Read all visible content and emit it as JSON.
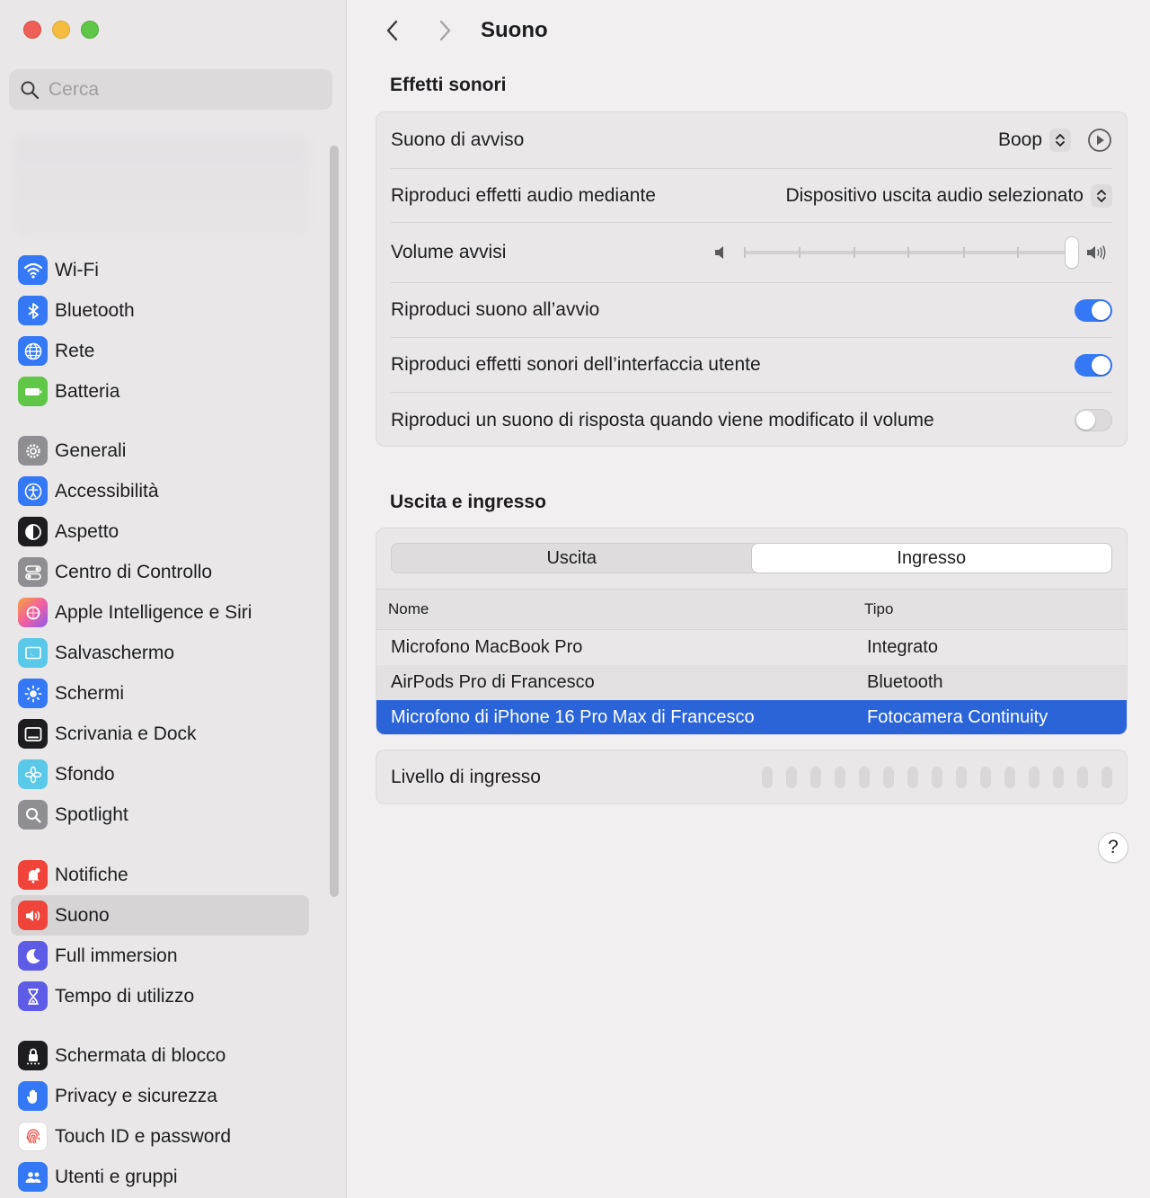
{
  "window": {
    "title": "Suono"
  },
  "sidebar": {
    "search_placeholder": "Cerca",
    "groups": [
      [
        {
          "label": "Wi-Fi",
          "icon": "wifi-icon",
          "color": "#3478f6"
        },
        {
          "label": "Bluetooth",
          "icon": "bluetooth-icon",
          "color": "#3478f6"
        },
        {
          "label": "Rete",
          "icon": "globe-icon",
          "color": "#3478f6"
        },
        {
          "label": "Batteria",
          "icon": "battery-icon",
          "color": "#5fc648"
        }
      ],
      [
        {
          "label": "Generali",
          "icon": "gear-icon",
          "color": "#8e8e93"
        },
        {
          "label": "Accessibilità",
          "icon": "accessibility-icon",
          "color": "#3478f6"
        },
        {
          "label": "Aspetto",
          "icon": "appearance-icon",
          "color": "#1d1d1f"
        },
        {
          "label": "Centro di Controllo",
          "icon": "control-center-icon",
          "color": "#8e8e93"
        },
        {
          "label": "Apple Intelligence e Siri",
          "icon": "siri-icon",
          "color": "#f25fa0"
        },
        {
          "label": "Salvaschermo",
          "icon": "screensaver-icon",
          "color": "#5ac8e8"
        },
        {
          "label": "Schermi",
          "icon": "sun-icon",
          "color": "#3478f6"
        },
        {
          "label": "Scrivania e Dock",
          "icon": "dock-icon",
          "color": "#1d1d1f"
        },
        {
          "label": "Sfondo",
          "icon": "flower-icon",
          "color": "#5ac8e8"
        },
        {
          "label": "Spotlight",
          "icon": "spotlight-icon",
          "color": "#8e8e93"
        }
      ],
      [
        {
          "label": "Notifiche",
          "icon": "bell-icon",
          "color": "#f0443a"
        },
        {
          "label": "Suono",
          "icon": "speaker-icon",
          "color": "#f0443a",
          "selected": true
        },
        {
          "label": "Full immersion",
          "icon": "moon-icon",
          "color": "#5e5ce6"
        },
        {
          "label": "Tempo di utilizzo",
          "icon": "hourglass-icon",
          "color": "#5e5ce6"
        }
      ],
      [
        {
          "label": "Schermata di blocco",
          "icon": "lock-icon",
          "color": "#1d1d1f"
        },
        {
          "label": "Privacy e sicurezza",
          "icon": "hand-icon",
          "color": "#3478f6"
        },
        {
          "label": "Touch ID e password",
          "icon": "fingerprint-icon",
          "color": "#ffffff"
        },
        {
          "label": "Utenti e gruppi",
          "icon": "users-icon",
          "color": "#3478f6"
        }
      ]
    ]
  },
  "effects": {
    "title": "Effetti sonori",
    "alert_sound_label": "Suono di avviso",
    "alert_sound_value": "Boop",
    "play_through_label": "Riproduci effetti audio mediante",
    "play_through_value": "Dispositivo uscita audio selezionato",
    "alert_volume_label": "Volume avvisi",
    "alert_volume_level": 1.0,
    "startup_sound_label": "Riproduci suono all’avvio",
    "startup_sound_on": true,
    "ui_sounds_label": "Riproduci effetti sonori dell’interfaccia utente",
    "ui_sounds_on": true,
    "volume_feedback_label": "Riproduci un suono di risposta quando viene modificato il volume",
    "volume_feedback_on": false
  },
  "io": {
    "title": "Uscita e ingresso",
    "tabs": [
      "Uscita",
      "Ingresso"
    ],
    "active_tab": "Ingresso",
    "columns": [
      "Nome",
      "Tipo"
    ],
    "rows": [
      {
        "name": "Microfono MacBook Pro",
        "type": "Integrato"
      },
      {
        "name": "AirPods Pro di Francesco",
        "type": "Bluetooth"
      },
      {
        "name": "Microfono di iPhone 16 Pro Max di Francesco",
        "type": "Fotocamera Continuity",
        "selected": true
      }
    ],
    "input_level_label": "Livello di ingresso",
    "input_level": 0
  },
  "help_label": "?",
  "colors": {
    "accent": "#3478f6",
    "selection": "#2a64d8"
  }
}
